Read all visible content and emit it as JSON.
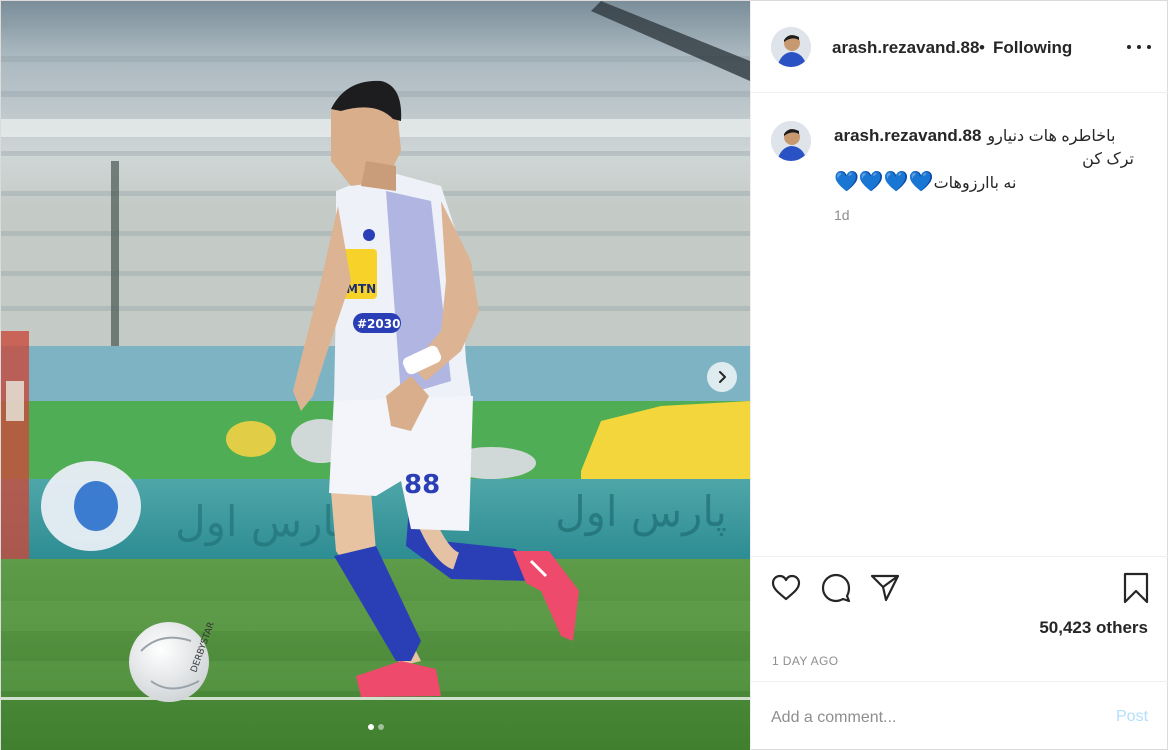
{
  "post": {
    "author": {
      "username": "arash.rezavand.88",
      "separator": "•",
      "follow_status": "Following"
    },
    "caption": {
      "username": "arash.rezavand.88",
      "line1": "باخاطره هات دنیارو",
      "line2": "ترک کن",
      "line3": "نه باارزوهات",
      "hearts": "💙💙💙💙",
      "time": "1d"
    },
    "likes_text": "50,423 others",
    "age": "1 DAY AGO",
    "comment": {
      "placeholder": "Add a comment...",
      "post_label": "Post"
    },
    "carousel": {
      "slide_count": 2,
      "current_slide": 1
    },
    "photo": {
      "jersey_number": "88",
      "sponsor": "MTN",
      "jersey_code": "#2030",
      "ball_text": "DERBYSTAR",
      "board_text": "پارس اول"
    },
    "icons": {
      "more": "more-options-icon",
      "like": "heart-icon",
      "comment": "comment-icon",
      "share": "paper-plane-icon",
      "save": "bookmark-icon",
      "next": "chevron-right-icon"
    },
    "colors": {
      "accent_blue_hearts": "#18b6d8",
      "post_button_disabled": "#b2dffc",
      "muted_text": "#8e8e8e"
    }
  }
}
